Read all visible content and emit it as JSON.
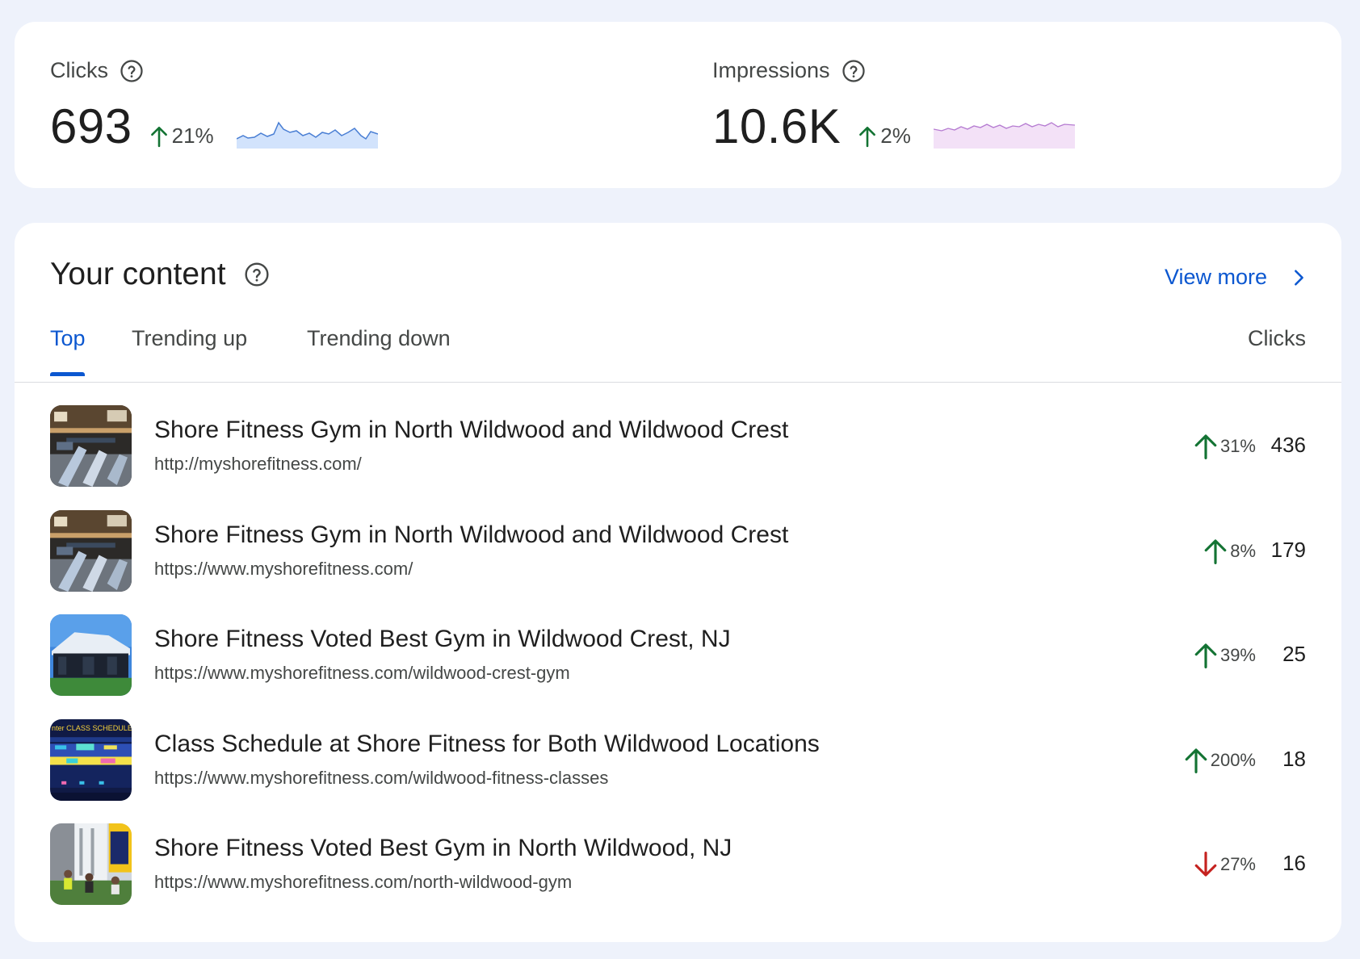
{
  "metrics": {
    "clicks": {
      "label": "Clicks",
      "value": "693",
      "change": "21%",
      "direction": "up",
      "sparkline_color": "#4a7fd4"
    },
    "impressions": {
      "label": "Impressions",
      "value": "10.6K",
      "change": "2%",
      "direction": "up",
      "sparkline_color": "#b57bd1"
    }
  },
  "content": {
    "title": "Your content",
    "view_more_label": "View more",
    "tabs": [
      {
        "label": "Top",
        "active": true
      },
      {
        "label": "Trending up",
        "active": false
      },
      {
        "label": "Trending down",
        "active": false
      }
    ],
    "column_header": "Clicks",
    "rows": [
      {
        "title": "Shore Fitness Gym in North Wildwood and Wildwood Crest",
        "url": "http://myshorefitness.com/",
        "change": "31%",
        "direction": "up",
        "clicks": "436",
        "thumb": "gym-interior"
      },
      {
        "title": "Shore Fitness Gym in North Wildwood and Wildwood Crest",
        "url": "https://www.myshorefitness.com/",
        "change": "8%",
        "direction": "up",
        "clicks": "179",
        "thumb": "gym-interior"
      },
      {
        "title": "Shore Fitness Voted Best Gym in Wildwood Crest, NJ",
        "url": "https://www.myshorefitness.com/wildwood-crest-gym",
        "change": "39%",
        "direction": "up",
        "clicks": "25",
        "thumb": "outdoor-tent"
      },
      {
        "title": "Class Schedule at Shore Fitness for Both Wildwood Locations",
        "url": "https://www.myshorefitness.com/wildwood-fitness-classes",
        "change": "200%",
        "direction": "up",
        "clicks": "18",
        "thumb": "class-schedule"
      },
      {
        "title": "Shore Fitness Voted Best Gym in North Wildwood, NJ",
        "url": "https://www.myshorefitness.com/north-wildwood-gym",
        "change": "27%",
        "direction": "down",
        "clicks": "16",
        "thumb": "outdoor-workout"
      }
    ],
    "thumb_schedule_text": "nter CLASS SCHEDULE"
  },
  "colors": {
    "accent": "#0b57d0",
    "up": "#137333",
    "down": "#c5221f"
  }
}
